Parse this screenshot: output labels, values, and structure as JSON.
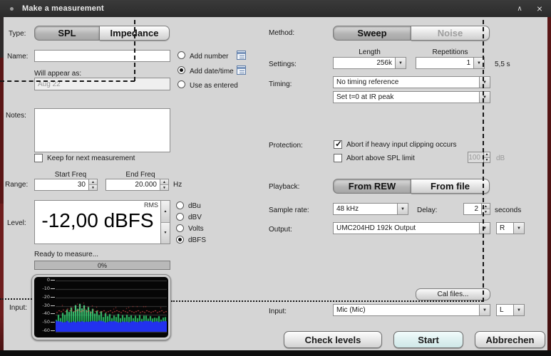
{
  "title_bar": {
    "title": "Make a measurement"
  },
  "left": {
    "type_label": "Type:",
    "type_options": [
      "SPL",
      "Impedance"
    ],
    "name_label": "Name:",
    "name_value": "",
    "naming_options": [
      "Add number",
      "Add date/time",
      "Use as entered"
    ],
    "will_appear_label": "Will appear as:",
    "will_appear_value": "Aug 22",
    "notes_label": "Notes:",
    "notes_value": "",
    "keep_label": "Keep for next measurement",
    "start_freq_label": "Start Freq",
    "end_freq_label": "End Freq",
    "range_label": "Range:",
    "start_freq_value": "30",
    "end_freq_value": "20.000",
    "hz_label": "Hz",
    "level_label": "Level:",
    "rms_label": "RMS",
    "level_value": "-12,00 dBFS",
    "level_units": [
      "dBu",
      "dBV",
      "Volts",
      "dBFS"
    ],
    "status_text": "Ready to measure...",
    "progress_text": "0%",
    "input_label": "Input:"
  },
  "right": {
    "method_label": "Method:",
    "method_options": [
      "Sweep",
      "Noise"
    ],
    "length_label": "Length",
    "repetitions_label": "Repetitions",
    "settings_label": "Settings:",
    "length_value": "256k",
    "repetitions_value": "1",
    "duration_text": "5,5 s",
    "timing_label": "Timing:",
    "timing_value_1": "No timing reference",
    "timing_value_2": "Set t=0 at IR peak",
    "protection_label": "Protection:",
    "protection_checks": [
      {
        "label": "Abort if heavy input clipping occurs",
        "checked": true
      },
      {
        "label": "Abort above SPL limit",
        "checked": false
      }
    ],
    "spl_limit_value": "100",
    "db_label": "dB",
    "playback_label": "Playback:",
    "playback_options": [
      "From REW",
      "From file"
    ],
    "sample_rate_label": "Sample rate:",
    "sample_rate_value": "48 kHz",
    "delay_label": "Delay:",
    "delay_value": "2",
    "seconds_label": "seconds",
    "output_label": "Output:",
    "output_value": "UMC204HD 192k Output",
    "output_channel": "R",
    "cal_files_label": "Cal files...",
    "input_label": "Input:",
    "input_value": "Mic (Mic)",
    "input_channel": "L"
  },
  "footer": {
    "check_levels": "Check levels",
    "start": "Start",
    "cancel": "Abbrechen"
  },
  "spectrum": {
    "axis_labels": [
      "0",
      "-10",
      "-20",
      "-30",
      "-40",
      "-50",
      "-60"
    ],
    "db_min": -60,
    "db_max": 0,
    "green_db": [
      -45,
      -41,
      -43,
      -38,
      -40,
      -34,
      -37,
      -31,
      -36,
      -29,
      -34,
      -28,
      -32,
      -30,
      -35,
      -31,
      -37,
      -33,
      -39,
      -35,
      -41,
      -36,
      -43,
      -38,
      -41,
      -39,
      -44,
      -40,
      -42,
      -39,
      -45,
      -41,
      -43,
      -40,
      -42,
      -41,
      -45,
      -42,
      -44,
      -41,
      -45,
      -42,
      -41,
      -44,
      -42,
      -45,
      -43,
      -44,
      -41,
      -45,
      -43,
      -42
    ],
    "red_db": [
      -37,
      -35,
      -36,
      -34,
      -36,
      -33,
      -35,
      -34,
      -36,
      -35,
      -34,
      -36,
      -35,
      -33,
      -36,
      -35,
      -37,
      -34,
      -36,
      -35,
      -37,
      -36,
      -35,
      -37,
      -36,
      -35,
      -37,
      -36,
      -35,
      -36,
      -37,
      -35,
      -36,
      -37,
      -35,
      -36,
      -37,
      -36,
      -35,
      -37,
      -36,
      -37,
      -35,
      -36,
      -37,
      -36,
      -35,
      -37,
      -36,
      -35,
      -37,
      -36
    ],
    "blue_top_db": -47,
    "colors": {
      "green": "#2fc46a",
      "green_hi": "#6cf0a0",
      "blue": "#2231ef",
      "red": "#e04848",
      "grid": "#3c3c3c",
      "bg": "#060606"
    }
  }
}
